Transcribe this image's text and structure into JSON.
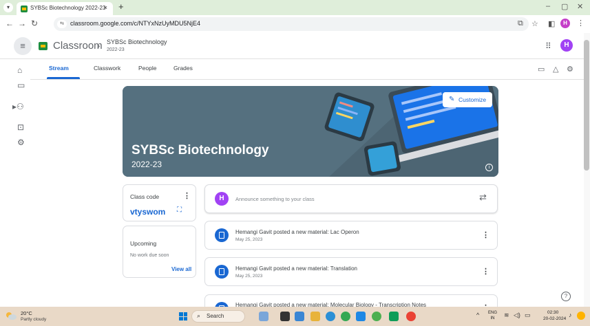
{
  "browser": {
    "tab_title": "SYBSc Biotechnology 2022-23",
    "tab_close": "×",
    "new_tab": "+",
    "url": "classroom.google.com/c/NTYxNzUyMDU5NjE4",
    "site_icon": "tune-icon",
    "profile_initial": "H",
    "win_minimize": "–",
    "win_restore": "▢",
    "win_close": "✕"
  },
  "header": {
    "menu_icon": "≡",
    "app_name": "Classroom",
    "separator": "›",
    "course_name": "SYBSc Biotechnology",
    "course_section": "2022-23",
    "user_initial": "H"
  },
  "tabs": [
    "Stream",
    "Classwork",
    "People",
    "Grades"
  ],
  "banner": {
    "title": "SYBSc Biotechnology",
    "year": "2022-23",
    "customize_label": "Customize",
    "info_icon": "i"
  },
  "class_code": {
    "label": "Class code",
    "value": "vtyswom"
  },
  "upcoming": {
    "title": "Upcoming",
    "empty_text": "No work due soon",
    "view_all": "View all"
  },
  "announce": {
    "avatar_initial": "H",
    "placeholder": "Announce something to your class"
  },
  "posts": [
    {
      "title": "Hemangi Gavit posted a new material: Lac Operon",
      "date": "May 25, 2023"
    },
    {
      "title": "Hemangi Gavit posted a new material: Translation",
      "date": "May 25, 2023"
    },
    {
      "title": "Hemangi Gavit posted a new material: Molecular Biology - Transcription Notes",
      "date": ""
    }
  ],
  "help_icon": "?",
  "taskbar": {
    "weather_temp": "20°C",
    "weather_desc": "Partly cloudy",
    "search_label": "Search",
    "lang_line1": "ENG",
    "lang_line2": "IN",
    "time": "02:30",
    "date": "20-02-2024"
  },
  "colors": {
    "accent": "#1967d2",
    "banner": "#55707f",
    "avatar": "#a142f4",
    "tabstrip": "#dfeeda",
    "taskbar": "#e9d9c7"
  }
}
